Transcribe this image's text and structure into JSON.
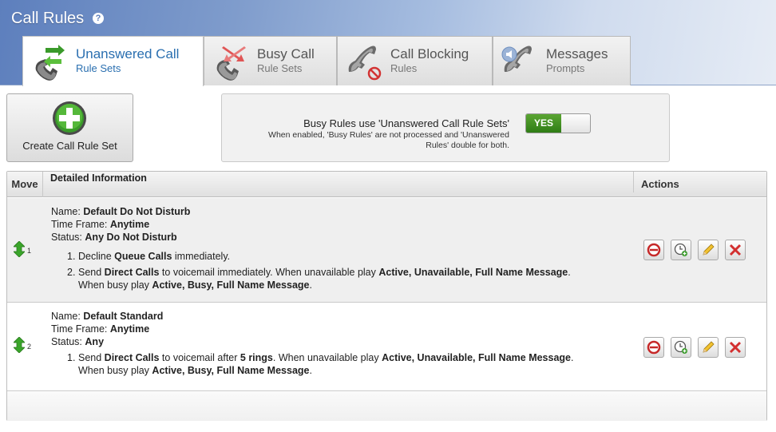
{
  "header": {
    "title": "Call Rules",
    "help_icon": "?"
  },
  "tabs": [
    {
      "label": "Unanswered Call",
      "sub": "Rule Sets",
      "icon": "phone-arrows-icon",
      "active": true
    },
    {
      "label": "Busy Call",
      "sub": "Rule Sets",
      "icon": "phone-busy-icon",
      "active": false
    },
    {
      "label": "Call Blocking",
      "sub": "Rules",
      "icon": "phone-blocked-icon",
      "active": false
    },
    {
      "label": "Messages",
      "sub": "Prompts",
      "icon": "phone-speaker-icon",
      "active": false
    }
  ],
  "create_button": {
    "label": "Create Call Rule Set",
    "icon": "plus-icon"
  },
  "busy_rules": {
    "title": "Busy Rules use 'Unanswered Call Rule Sets'",
    "description": "When enabled, 'Busy Rules' are not processed and 'Unanswered Rules' double for both.",
    "toggle_label": "YES",
    "enabled": true
  },
  "table": {
    "headers": {
      "move": "Move",
      "info": "Detailed Information",
      "actions": "Actions"
    },
    "rows": [
      {
        "order": "1",
        "name_label": "Name:",
        "name": "Default Do Not Disturb",
        "timeframe_label": "Time Frame:",
        "timeframe": "Anytime",
        "status_label": "Status:",
        "status": "Any Do Not Disturb",
        "steps": [
          {
            "num": "1.",
            "parts": [
              "Decline ",
              "Queue Calls",
              " immediately."
            ]
          },
          {
            "num": "2.",
            "parts": [
              "Send ",
              "Direct Calls",
              " to voicemail immediately. When unavailable play ",
              "Active, Unavailable, Full Name Message",
              ".",
              "When busy play ",
              "Active, Busy, Full Name Message",
              "."
            ]
          }
        ]
      },
      {
        "order": "2",
        "name_label": "Name:",
        "name": "Default Standard",
        "timeframe_label": "Time Frame:",
        "timeframe": "Anytime",
        "status_label": "Status:",
        "status": "Any",
        "steps": [
          {
            "num": "1.",
            "parts": [
              "Send ",
              "Direct Calls",
              " to voicemail after ",
              "5 rings",
              ". When unavailable play ",
              "Active, Unavailable, Full Name Message",
              ".",
              "When busy play ",
              "Active, Busy, Full Name Message",
              "."
            ]
          }
        ]
      }
    ]
  },
  "actions": [
    "disable-icon",
    "schedule-icon",
    "edit-icon",
    "delete-icon"
  ]
}
